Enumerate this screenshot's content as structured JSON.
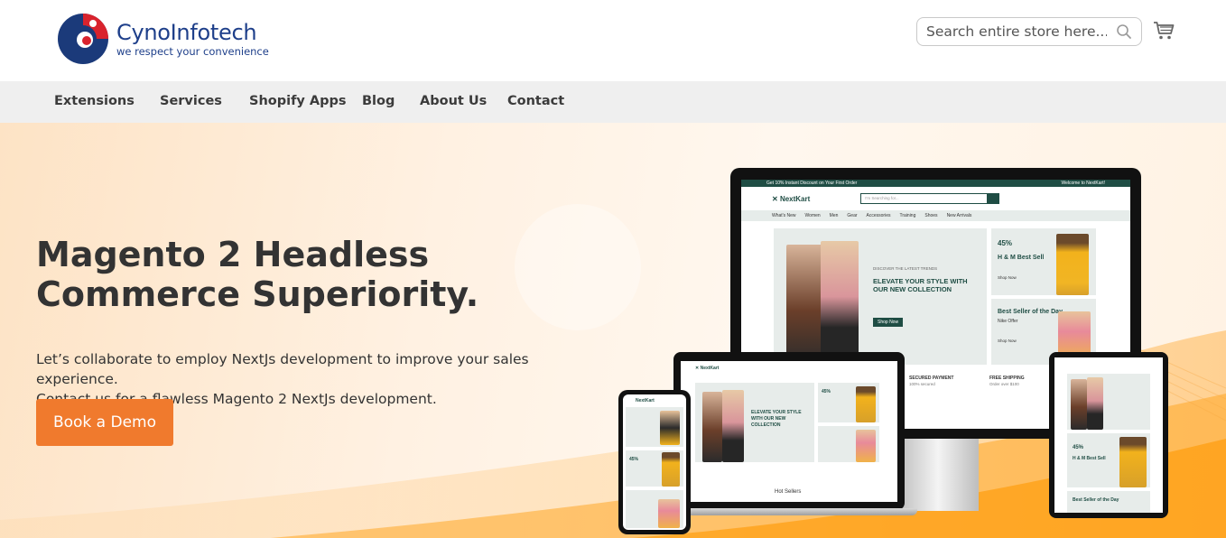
{
  "header": {
    "logo": {
      "name": "CynoInfotech",
      "tagline": "we respect your convenience"
    },
    "search": {
      "placeholder": "Search entire store here..."
    },
    "icons": {
      "search": "search-icon",
      "cart": "cart-icon"
    }
  },
  "nav": {
    "items": [
      {
        "label": "Extensions"
      },
      {
        "label": "Services"
      },
      {
        "label": "Shopify Apps"
      },
      {
        "label": "Blog"
      },
      {
        "label": "About Us"
      },
      {
        "label": "Contact"
      }
    ]
  },
  "hero": {
    "title_line1": "Magento 2 Headless",
    "title_line2": "Commerce Superiority.",
    "subtitle_line1": "Let’s collaborate to employ NextJs development to improve your sales experience.",
    "subtitle_line2": "Contact us for a flawless Magento 2 NextJs development.",
    "cta": "Book a Demo"
  },
  "mockup": {
    "topbar_left": "Get 10% Instant Discount on Your First Order",
    "topbar_right": "Welcome to NextKart!",
    "brand": "NextKart",
    "search_placeholder": "I'm Searching for...",
    "menu": [
      "What's New",
      "Women",
      "Men",
      "Gear",
      "Accessories",
      "Training",
      "Shoes",
      "New Arrivals"
    ],
    "banner_kicker": "DISCOVER THE LATEST TRENDS",
    "banner_title": "ELEVATE YOUR STYLE WITH OUR NEW COLLECTION",
    "banner_button": "Shop Now",
    "promo1_pct": "45%",
    "promo1_title": "H & M Best Sell",
    "promo1_link": "Shop Now",
    "promo2_title": "Best Seller of the Day",
    "promo2_sub": "Nike Offer",
    "promo2_link": "Shop Now",
    "feature1": "SECURED PAYMENT",
    "feature1_sub": "100% secured",
    "feature2": "FREE SHIPPING",
    "feature2_sub": "Order over $100",
    "hot_sellers": "Hot Sellers"
  },
  "colors": {
    "brand_blue": "#1e3f8a",
    "accent_orange": "#f07a2d",
    "mockup_green": "#1f4d44"
  }
}
